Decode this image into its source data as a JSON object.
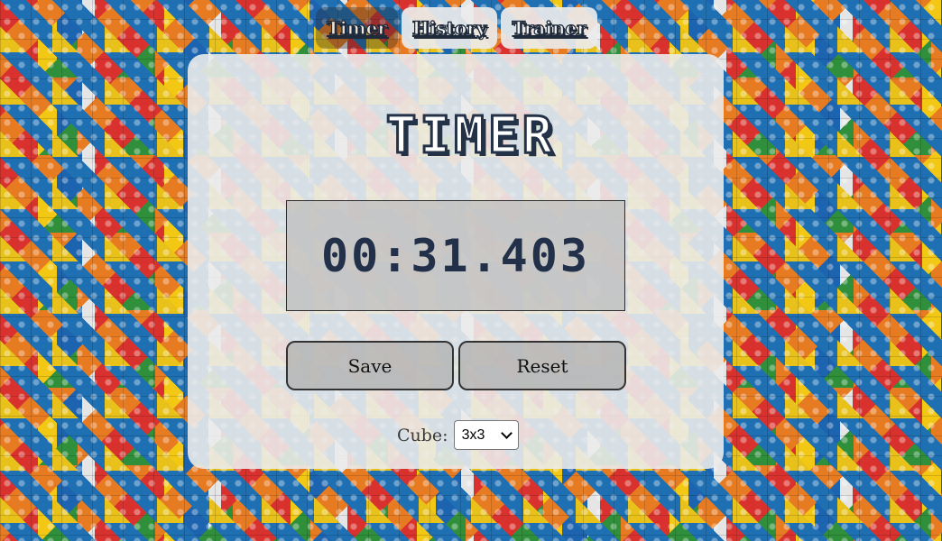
{
  "nav": {
    "tabs": [
      {
        "label": "Timer",
        "active": true
      },
      {
        "label": "History",
        "active": false
      },
      {
        "label": "Trainer",
        "active": false
      }
    ]
  },
  "timer": {
    "title": "TIMER",
    "time": "00:31.403",
    "save_label": "Save",
    "reset_label": "Reset"
  },
  "cube": {
    "label": "Cube:",
    "selected": "3x3"
  },
  "colors": {
    "title_outline": "#243247",
    "display_text": "#223049",
    "card_bg": "#ebebeb"
  }
}
